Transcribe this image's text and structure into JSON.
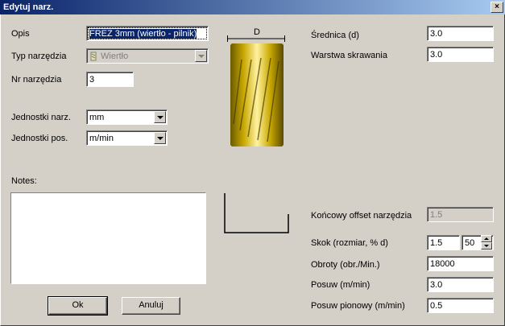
{
  "window": {
    "title": "Edytuj narz.",
    "close_glyph": "×"
  },
  "form": {
    "opis_label": "Opis",
    "opis_value": "FREZ 3mm (wiertło - pilnik)",
    "typ_label": "Typ narzędzia",
    "typ_value": "Wiertło",
    "typ_icon": "drill-icon",
    "nr_label": "Nr narzędzia",
    "nr_value": "3",
    "jedn_narz_label": "Jednostki narz.",
    "jedn_narz_value": "mm",
    "jedn_pos_label": "Jednostki pos.",
    "jedn_pos_value": "m/min",
    "notes_label": "Notes:",
    "notes_value": ""
  },
  "diagram": {
    "dimension_label": "D"
  },
  "params": {
    "srednica_label": "Średnica (d)",
    "srednica_value": "3.0",
    "warstwa_label": "Warstwa skrawania",
    "warstwa_value": "3.0",
    "offset_label": "Końcowy offset narzędzia",
    "offset_value": "1.5",
    "skok_label": "Skok (rozmiar, % d)",
    "skok_value": "1.5",
    "skok_percent": "50",
    "obroty_label": "Obroty (obr./Min.)",
    "obroty_value": "18000",
    "posuw_label": "Posuw (m/min)",
    "posuw_value": "3.0",
    "posuw_pion_label": "Posuw pionowy (m/min)",
    "posuw_pion_value": "0.5"
  },
  "buttons": {
    "ok": "Ok",
    "cancel": "Anuluj"
  },
  "colors": {
    "title_start": "#0a246a",
    "title_end": "#a6caf0",
    "face": "#d4d0c8",
    "gold": "#c8a800"
  }
}
